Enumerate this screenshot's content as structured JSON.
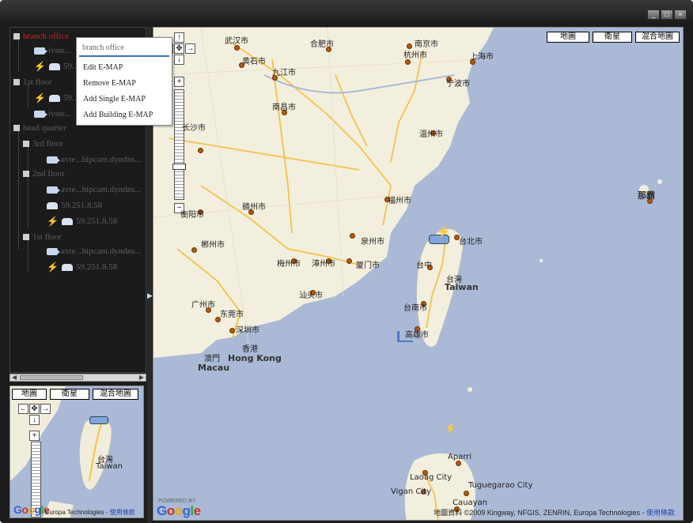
{
  "window": {
    "controls": [
      "_",
      "□",
      "×"
    ]
  },
  "tree": {
    "nodes": [
      {
        "label": "branch office",
        "type": "group",
        "red": true
      },
      {
        "label": "ivste...",
        "type": "camera",
        "red": false
      },
      {
        "label": "59...",
        "type": "dvr",
        "red": false,
        "alarm": true
      },
      {
        "label": "1st floor",
        "type": "group",
        "red": false
      },
      {
        "label": "59...",
        "type": "dvr",
        "red": false,
        "alarm": true
      },
      {
        "label": "ivste...",
        "type": "camera",
        "red": false
      },
      {
        "label": "head quarter",
        "type": "group",
        "red": false
      },
      {
        "label": "3rd floor",
        "type": "group",
        "red": false
      },
      {
        "label": "avte...hipcam.dyndns...",
        "type": "camera",
        "red": false
      },
      {
        "label": "2nd floor",
        "type": "group",
        "red": false
      },
      {
        "label": "avte...hipcam.dyndns...",
        "type": "camera",
        "red": false
      },
      {
        "label": "59.251.8.58",
        "type": "dvr",
        "red": false
      },
      {
        "label": "59.251.8.58",
        "type": "dvr",
        "red": false,
        "alarm": true
      },
      {
        "label": "1st floor",
        "type": "group",
        "red": false
      },
      {
        "label": "avte...hipcam.dyndns...",
        "type": "camera",
        "red": false
      },
      {
        "label": "59...",
        "type": "dvr",
        "red": false
      },
      {
        "label": "59.251.8.58",
        "type": "dvr",
        "red": false,
        "alarm": true
      }
    ]
  },
  "context_menu": {
    "input_value": "branch office",
    "items": [
      "Edit E-MAP",
      "Remove E-MAP",
      "Add Single E-MAP",
      "Add Building E-MAP"
    ]
  },
  "main_map": {
    "map_types": [
      "地圖",
      "衛星",
      "混合地圖"
    ],
    "zoom_in": "+",
    "zoom_out": "−",
    "pan": {
      "up": "↑",
      "left": "←",
      "center": "✥",
      "right": "→",
      "down": "↓"
    },
    "cities": [
      {
        "name": "武汉市"
      },
      {
        "name": "合肥市"
      },
      {
        "name": "南京市"
      },
      {
        "name": "黄石市"
      },
      {
        "name": "九江市"
      },
      {
        "name": "杭州市"
      },
      {
        "name": "上海市"
      },
      {
        "name": "宁波市"
      },
      {
        "name": "南昌市"
      },
      {
        "name": "温州市"
      },
      {
        "name": "福州市"
      },
      {
        "name": "泉州市"
      },
      {
        "name": "厦门市"
      },
      {
        "name": "台北市"
      },
      {
        "name": "台中"
      },
      {
        "name": "台南市"
      },
      {
        "name": "高雄市"
      },
      {
        "name": "广州市"
      },
      {
        "name": "东莞市"
      },
      {
        "name": "深圳市"
      },
      {
        "name": "香港"
      },
      {
        "name": "Hong Kong"
      },
      {
        "name": "澳門"
      },
      {
        "name": "Macau"
      },
      {
        "name": "汕头市"
      },
      {
        "name": "梅州市"
      },
      {
        "name": "漳州市"
      },
      {
        "name": "长沙市"
      },
      {
        "name": "衡阳市"
      },
      {
        "name": "赣州市"
      },
      {
        "name": "郴州市"
      },
      {
        "name": "那霸"
      },
      {
        "name": "Taiwan"
      },
      {
        "name": "台灣"
      },
      {
        "name": "Aparri"
      },
      {
        "name": "Laoag City"
      },
      {
        "name": "Vigan City"
      },
      {
        "name": "Tuguegarao City"
      },
      {
        "name": "Cauayan"
      }
    ],
    "copyright": "地圖資料 ©2009 Kingway, NFGIS, ZENRIN, Europa Technologies -",
    "terms_link": "使用條款",
    "logo": "Google",
    "powered_by": "POWERED BY"
  },
  "mini_map": {
    "map_types": [
      "地圖",
      "衛星",
      "混合地圖"
    ],
    "zoom_in": "+",
    "labels": [
      "台灣",
      "Taiwan"
    ],
    "copyright": "Europa Technologies -",
    "terms_link": "使用條款",
    "logo": "Google"
  }
}
